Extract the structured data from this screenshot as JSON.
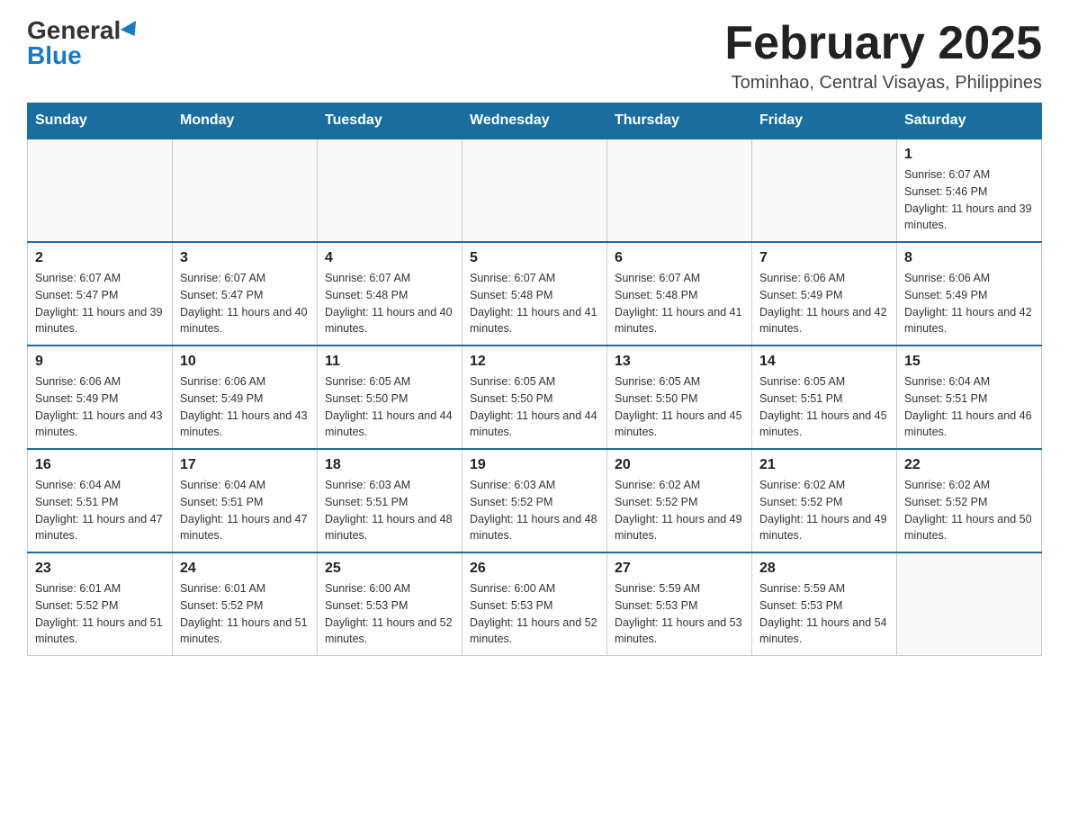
{
  "logo": {
    "general": "General",
    "blue": "Blue"
  },
  "title": {
    "month_year": "February 2025",
    "location": "Tominhao, Central Visayas, Philippines"
  },
  "days_of_week": [
    "Sunday",
    "Monday",
    "Tuesday",
    "Wednesday",
    "Thursday",
    "Friday",
    "Saturday"
  ],
  "weeks": [
    [
      {
        "day": "",
        "info": ""
      },
      {
        "day": "",
        "info": ""
      },
      {
        "day": "",
        "info": ""
      },
      {
        "day": "",
        "info": ""
      },
      {
        "day": "",
        "info": ""
      },
      {
        "day": "",
        "info": ""
      },
      {
        "day": "1",
        "info": "Sunrise: 6:07 AM\nSunset: 5:46 PM\nDaylight: 11 hours and 39 minutes."
      }
    ],
    [
      {
        "day": "2",
        "info": "Sunrise: 6:07 AM\nSunset: 5:47 PM\nDaylight: 11 hours and 39 minutes."
      },
      {
        "day": "3",
        "info": "Sunrise: 6:07 AM\nSunset: 5:47 PM\nDaylight: 11 hours and 40 minutes."
      },
      {
        "day": "4",
        "info": "Sunrise: 6:07 AM\nSunset: 5:48 PM\nDaylight: 11 hours and 40 minutes."
      },
      {
        "day": "5",
        "info": "Sunrise: 6:07 AM\nSunset: 5:48 PM\nDaylight: 11 hours and 41 minutes."
      },
      {
        "day": "6",
        "info": "Sunrise: 6:07 AM\nSunset: 5:48 PM\nDaylight: 11 hours and 41 minutes."
      },
      {
        "day": "7",
        "info": "Sunrise: 6:06 AM\nSunset: 5:49 PM\nDaylight: 11 hours and 42 minutes."
      },
      {
        "day": "8",
        "info": "Sunrise: 6:06 AM\nSunset: 5:49 PM\nDaylight: 11 hours and 42 minutes."
      }
    ],
    [
      {
        "day": "9",
        "info": "Sunrise: 6:06 AM\nSunset: 5:49 PM\nDaylight: 11 hours and 43 minutes."
      },
      {
        "day": "10",
        "info": "Sunrise: 6:06 AM\nSunset: 5:49 PM\nDaylight: 11 hours and 43 minutes."
      },
      {
        "day": "11",
        "info": "Sunrise: 6:05 AM\nSunset: 5:50 PM\nDaylight: 11 hours and 44 minutes."
      },
      {
        "day": "12",
        "info": "Sunrise: 6:05 AM\nSunset: 5:50 PM\nDaylight: 11 hours and 44 minutes."
      },
      {
        "day": "13",
        "info": "Sunrise: 6:05 AM\nSunset: 5:50 PM\nDaylight: 11 hours and 45 minutes."
      },
      {
        "day": "14",
        "info": "Sunrise: 6:05 AM\nSunset: 5:51 PM\nDaylight: 11 hours and 45 minutes."
      },
      {
        "day": "15",
        "info": "Sunrise: 6:04 AM\nSunset: 5:51 PM\nDaylight: 11 hours and 46 minutes."
      }
    ],
    [
      {
        "day": "16",
        "info": "Sunrise: 6:04 AM\nSunset: 5:51 PM\nDaylight: 11 hours and 47 minutes."
      },
      {
        "day": "17",
        "info": "Sunrise: 6:04 AM\nSunset: 5:51 PM\nDaylight: 11 hours and 47 minutes."
      },
      {
        "day": "18",
        "info": "Sunrise: 6:03 AM\nSunset: 5:51 PM\nDaylight: 11 hours and 48 minutes."
      },
      {
        "day": "19",
        "info": "Sunrise: 6:03 AM\nSunset: 5:52 PM\nDaylight: 11 hours and 48 minutes."
      },
      {
        "day": "20",
        "info": "Sunrise: 6:02 AM\nSunset: 5:52 PM\nDaylight: 11 hours and 49 minutes."
      },
      {
        "day": "21",
        "info": "Sunrise: 6:02 AM\nSunset: 5:52 PM\nDaylight: 11 hours and 49 minutes."
      },
      {
        "day": "22",
        "info": "Sunrise: 6:02 AM\nSunset: 5:52 PM\nDaylight: 11 hours and 50 minutes."
      }
    ],
    [
      {
        "day": "23",
        "info": "Sunrise: 6:01 AM\nSunset: 5:52 PM\nDaylight: 11 hours and 51 minutes."
      },
      {
        "day": "24",
        "info": "Sunrise: 6:01 AM\nSunset: 5:52 PM\nDaylight: 11 hours and 51 minutes."
      },
      {
        "day": "25",
        "info": "Sunrise: 6:00 AM\nSunset: 5:53 PM\nDaylight: 11 hours and 52 minutes."
      },
      {
        "day": "26",
        "info": "Sunrise: 6:00 AM\nSunset: 5:53 PM\nDaylight: 11 hours and 52 minutes."
      },
      {
        "day": "27",
        "info": "Sunrise: 5:59 AM\nSunset: 5:53 PM\nDaylight: 11 hours and 53 minutes."
      },
      {
        "day": "28",
        "info": "Sunrise: 5:59 AM\nSunset: 5:53 PM\nDaylight: 11 hours and 54 minutes."
      },
      {
        "day": "",
        "info": ""
      }
    ]
  ]
}
